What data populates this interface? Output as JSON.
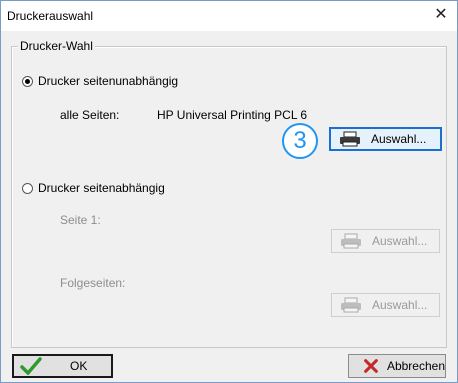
{
  "window": {
    "title": "Druckerauswahl",
    "close_glyph": "✕"
  },
  "group": {
    "label": "Drucker-Wahl"
  },
  "option_independent": {
    "label": "Drucker seitenunabhängig",
    "selected": true,
    "all_pages_label": "alle Seiten:",
    "printer_name": "HP Universal Printing PCL 6",
    "select_button": "Auswahl..."
  },
  "callout": {
    "number": "3",
    "color": "#2196f3"
  },
  "option_dependent": {
    "label": "Drucker seitenabhängig",
    "selected": false,
    "page1_label": "Seite 1:",
    "page1_button": "Auswahl...",
    "following_label": "Folgeseiten:",
    "following_button": "Auswahl..."
  },
  "footer": {
    "ok_label": "OK",
    "cancel_label": "Abbrechen"
  },
  "icons": {
    "printer": "printer-icon",
    "ok": "checkmark-icon",
    "cancel": "red-x-icon"
  }
}
